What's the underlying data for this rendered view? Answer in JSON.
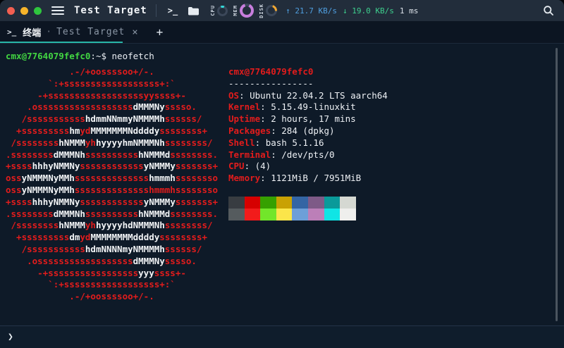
{
  "window": {
    "title": "Test Target"
  },
  "topbar": {
    "terminal_icon_label": ">_",
    "net_up": "↑ 21.7 KB/s",
    "net_down": "↓ 19.0 KB/s",
    "latency": "1 ms",
    "gauges": [
      {
        "label": "CPU",
        "color": "#35dbdb",
        "track": "#3b4759",
        "percent": 12,
        "start": -20,
        "size": 15,
        "thick": false
      },
      {
        "label": "MEM",
        "color": "#c77edd",
        "track": "#3b4759",
        "percent": 88,
        "start": 25,
        "size": 20,
        "thick": true
      },
      {
        "label": "DISK",
        "color": "#f0a732",
        "track": "#3b4759",
        "percent": 22,
        "start": 15,
        "size": 16,
        "thick": false
      }
    ]
  },
  "tabbar": {
    "prompt_icon_label": ">_",
    "group_label": "终端",
    "separator": "·",
    "tab_title": "Test Target",
    "close_label": "×",
    "new_tab_label": "+"
  },
  "terminal": {
    "colors": {
      "c1": "#e21c1c",
      "c2": "#f2f4f6",
      "green": "#42d642",
      "fg": "#e9edf2"
    },
    "prompt": {
      "user_host": "cmx@7764079fefc0",
      "path_suffix": ":~$",
      "command": "neofetch"
    },
    "ascii_art": [
      [
        [
          "c1",
          "            .-/+oossssoo+/-."
        ]
      ],
      [
        [
          "c1",
          "        `:+ssssssssssssssssss+:`"
        ]
      ],
      [
        [
          "c1",
          "      -+ssssssssssssssssssyyssss+-"
        ]
      ],
      [
        [
          "c1",
          "    .ossssssssssssssssss"
        ],
        [
          "c2",
          "dMMMNy"
        ],
        [
          "c1",
          "sssso."
        ]
      ],
      [
        [
          "c1",
          "   /sssssssssss"
        ],
        [
          "c2",
          "hdmmNNmmyNMMMMh"
        ],
        [
          "c1",
          "ssssss/"
        ]
      ],
      [
        [
          "c1",
          "  +sssssssss"
        ],
        [
          "c2",
          "hm"
        ],
        [
          "c1",
          "yd"
        ],
        [
          "c2",
          "MMMMMMMNddddy"
        ],
        [
          "c1",
          "ssssssss+"
        ]
      ],
      [
        [
          "c1",
          " /ssssssss"
        ],
        [
          "c2",
          "hNMMM"
        ],
        [
          "c1",
          "yh"
        ],
        [
          "c2",
          "hyyyyhmNMMMNh"
        ],
        [
          "c1",
          "ssssssss/"
        ]
      ],
      [
        [
          "c1",
          ".ssssssss"
        ],
        [
          "c2",
          "dMMMNh"
        ],
        [
          "c1",
          "ssssssssss"
        ],
        [
          "c2",
          "hNMMMd"
        ],
        [
          "c1",
          "ssssssss."
        ]
      ],
      [
        [
          "c1",
          "+ssss"
        ],
        [
          "c2",
          "hhhyNMMNy"
        ],
        [
          "c1",
          "ssssssssssss"
        ],
        [
          "c2",
          "yNMMMy"
        ],
        [
          "c1",
          "sssssss+"
        ]
      ],
      [
        [
          "c1",
          "oss"
        ],
        [
          "c2",
          "yNMMMNyMMh"
        ],
        [
          "c1",
          "ssssssssssssss"
        ],
        [
          "c2",
          "hmmmh"
        ],
        [
          "c1",
          "ssssssso"
        ]
      ],
      [
        [
          "c1",
          "oss"
        ],
        [
          "c2",
          "yNMMMNyMMh"
        ],
        [
          "c1",
          "sssssssssssssshmmmhssssssso"
        ]
      ],
      [
        [
          "c1",
          "+ssss"
        ],
        [
          "c2",
          "hhhyNMMNy"
        ],
        [
          "c1",
          "ssssssssssss"
        ],
        [
          "c2",
          "yNMMMy"
        ],
        [
          "c1",
          "sssssss+"
        ]
      ],
      [
        [
          "c1",
          ".ssssssss"
        ],
        [
          "c2",
          "dMMMNh"
        ],
        [
          "c1",
          "ssssssssss"
        ],
        [
          "c2",
          "hNMMMd"
        ],
        [
          "c1",
          "ssssssss."
        ]
      ],
      [
        [
          "c1",
          " /ssssssss"
        ],
        [
          "c2",
          "hNMMM"
        ],
        [
          "c1",
          "yh"
        ],
        [
          "c2",
          "hyyyyhdNMMMNh"
        ],
        [
          "c1",
          "ssssssss/"
        ]
      ],
      [
        [
          "c1",
          "  +sssssssss"
        ],
        [
          "c2",
          "dm"
        ],
        [
          "c1",
          "yd"
        ],
        [
          "c2",
          "MMMMMMMMddddy"
        ],
        [
          "c1",
          "ssssssss+"
        ]
      ],
      [
        [
          "c1",
          "   /sssssssssss"
        ],
        [
          "c2",
          "hdmNNNNmyNMMMMh"
        ],
        [
          "c1",
          "ssssss/"
        ]
      ],
      [
        [
          "c1",
          "    .ossssssssssssssssss"
        ],
        [
          "c2",
          "dMMMNy"
        ],
        [
          "c1",
          "sssso."
        ]
      ],
      [
        [
          "c1",
          "      -+sssssssssssssssss"
        ],
        [
          "c2",
          "yyy"
        ],
        [
          "c1",
          "ssss+-"
        ]
      ],
      [
        [
          "c1",
          "        `:+ssssssssssssssssss+:`"
        ]
      ],
      [
        [
          "c1",
          "            .-/+oossssoo+/-."
        ]
      ]
    ],
    "info": {
      "title": "cmx@7764079fefc0",
      "separator": "----------------",
      "rows": [
        {
          "label": "OS",
          "value": "Ubuntu 22.04.2 LTS aarch64"
        },
        {
          "label": "Kernel",
          "value": "5.15.49-linuxkit"
        },
        {
          "label": "Uptime",
          "value": "2 hours, 17 mins"
        },
        {
          "label": "Packages",
          "value": "284 (dpkg)"
        },
        {
          "label": "Shell",
          "value": "bash 5.1.16"
        },
        {
          "label": "Terminal",
          "value": "/dev/pts/0"
        },
        {
          "label": "CPU",
          "value": "(4)"
        },
        {
          "label": "Memory",
          "value": "1121MiB / 7951MiB"
        }
      ]
    },
    "palette": {
      "row1": [
        "#383c41",
        "#d60000",
        "#36a000",
        "#c9a103",
        "#3465a4",
        "#7e5a87",
        "#0a9a9a",
        "#d5d8d2"
      ],
      "row2": [
        "#555b5e",
        "#f21b1b",
        "#72e62a",
        "#fbe54a",
        "#6d9fd8",
        "#bc7fb8",
        "#10e5e5",
        "#efefed"
      ]
    }
  },
  "bottombar": {
    "chevron": "❯"
  }
}
